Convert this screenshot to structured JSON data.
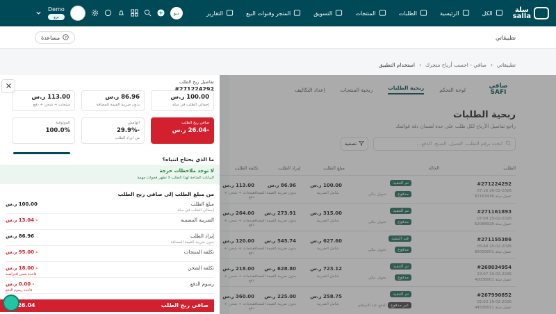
{
  "topbar": {
    "logo": "سلة\nsalla",
    "nav": [
      {
        "label": "الكل",
        "icon": "menu-icon"
      },
      {
        "label": "الرئيسية",
        "icon": "home-icon"
      },
      {
        "label": "الطلبات",
        "icon": "orders-icon"
      },
      {
        "label": "المنتجات",
        "icon": "products-icon"
      },
      {
        "label": "التسويق",
        "icon": "marketing-icon"
      },
      {
        "label": "المتجر وقنوات البيع",
        "icon": "store-channels-icon"
      },
      {
        "label": "التقارير",
        "icon": "reports-icon"
      }
    ],
    "avatar_text": "ديو",
    "user_name": "Demo",
    "user_badge": "برو"
  },
  "subbar": {
    "apps_label": "تطبيقاتي",
    "help_label": "مساعدة"
  },
  "breadcrumb": [
    "تطبيقاتي",
    "صافي - احسب أرباح متجرك",
    "استخدام التطبيق"
  ],
  "app": {
    "logo": "صافي\nSAFI",
    "tabs": [
      "لوحة التحكم",
      "ربحية الطلبات",
      "ربحية المنتجات",
      "إعداد التكاليف"
    ],
    "active_tab": 1,
    "title": "ربحية الطلبات",
    "subtitle": "راجع تفاصيل الأرباح لكل طلب على حدة لضمان دقة قوائمك",
    "search_placeholder": "ابحث برقم الطلب، العميل، المنتج، الدفع...",
    "filter_label": "تصفية",
    "columns": [
      "الطلب",
      "الحالة",
      "مبلغ الطلب",
      "إيراد الطلب",
      "تكلفة الطلب"
    ],
    "rows": [
      {
        "id": "#271224292",
        "date": "26-02-2026 07:16",
        "customer": "عميل سلة 82163436",
        "status": "تم التنفيذ",
        "payment": "مدفوع",
        "shipping": "تحويل بنكي",
        "amount": "100.00 ر.س",
        "amount_sub": "شامل الضريبة",
        "revenue": "86.96 ر.س",
        "revenue_sub": "بدون ضريبة القيمة المضافة",
        "cost": "113.00 ر.س",
        "cost_sub": "منتجات + شحن + دفع"
      },
      {
        "id": "#271161893",
        "date": "25-02-2026 07:09",
        "customer": "عميل سلة 62088928",
        "status": "تم التنفيذ",
        "payment": "مدفوع",
        "shipping": "تحويل بنكي",
        "amount": "315.00 ر.س",
        "amount_sub": "شامل الضريبة",
        "revenue": "273.91 ر.س",
        "revenue_sub": "بدون ضريبة القيمة المضافة",
        "cost": "264.00 ر.س",
        "cost_sub": "منتجات + شحن + دفع"
      },
      {
        "id": "#271155386",
        "date": "25-02-2026 05:48",
        "customer": "عميل سلة 85009001",
        "status": "قيد التنفيذ",
        "payment": "مدفوع",
        "shipping": "تحويل بنكي",
        "amount": "627.60 ر.س",
        "amount_sub": "شامل الضريبة",
        "revenue": "545.74 ر.س",
        "revenue_sub": "بدون ضريبة القيمة المضافة",
        "cost": "120.00 ر.س",
        "cost_sub": "منتجات + شحن + دفع"
      },
      {
        "id": "#268034954",
        "date": "19-02-2026 22:07",
        "customer": "عميل سلة 40038001",
        "status": "تم التنفيذ",
        "payment": "مدفوع",
        "shipping": "تحويل بنكي",
        "amount": "723.12 ر.س",
        "amount_sub": "شامل الضريبة",
        "revenue": "628.80 ر.س",
        "revenue_sub": "بدون ضريبة القيمة المضافة",
        "cost": "218.00 ر.س",
        "cost_sub": "منتجات + شحن + دفع"
      },
      {
        "id": "#267990852",
        "date": "19-02-2026 02:03",
        "customer": "عميل سلة 44538011",
        "status": "تم التنفيذ",
        "payment": "غير مدفوع",
        "shipping": "الدفع عند الاستلام",
        "amount": "258.75 ر.س",
        "amount_sub": "شامل الضريبة",
        "revenue": "225.00 ر.س",
        "revenue_sub": "بدون ضريبة القيمة المضافة",
        "cost": "360.00 ر.س",
        "cost_sub": "منتجات + شحن + دفع"
      }
    ]
  },
  "panel": {
    "title": "تفاصيل ربح الطلب",
    "order_no": "#271224292",
    "metrics": [
      {
        "value": "100.00 ر.س",
        "label": "إجمالي الطلب في سلة",
        "style": "normal"
      },
      {
        "value": "86.96 ر.س",
        "label": "بدون ضريبة القيمة المضافة",
        "style": "normal"
      },
      {
        "value": "113.00 ر.س",
        "label": "منتجات + شحن + دفع",
        "style": "normal"
      },
      {
        "title": "صافي ربح الطلب",
        "value": "-26.04 ر.س",
        "label": "",
        "style": "red"
      },
      {
        "title": "الهامش",
        "value": "-29.9%",
        "label": "من ايراد الطلب",
        "style": "normal"
      },
      {
        "title": "الموثوقية",
        "value": "100.0%",
        "label": "",
        "style": "progress",
        "progress": 1.0
      }
    ],
    "attention_title": "ما الذي يحتاج انتباه؟",
    "ok_title": "لا توجد ملاحظات حرجة",
    "ok_sub": "البيانات المتاحة لهذا الطلب لا تظهر فجوات مهمة",
    "breakdown_title": "من مبلغ الطلب إلى صافي ربح الطلب",
    "lines": [
      {
        "label": "مبلغ الطلب",
        "sub": "إجمالي الطلب في سلة",
        "value": "100.00 ر.س",
        "vsub": "",
        "neg": false
      },
      {
        "label": "الضريبة المضمنة",
        "sub": "",
        "value": "- 13.04 ر.س",
        "vsub": "",
        "neg": true
      },
      {
        "label": "إيراد الطلب",
        "sub": "بدون ضريبة القيمة المضافة",
        "value": "86.96 ر.س",
        "vsub": "",
        "neg": false
      },
      {
        "label": "تكلفة المنتجات",
        "sub": "",
        "value": "- 95.00 ر.س",
        "vsub": "",
        "neg": true
      },
      {
        "label": "تكلفة الشحن",
        "sub": "",
        "value": "- 18.00 ر.س",
        "vsub": "قاعدة شحن افتراضية",
        "neg": true
      },
      {
        "label": "رسوم الدفع",
        "sub": "",
        "value": "- 0.00 ر.س",
        "vsub": "قاعدة رسوم الدفع",
        "neg": true
      }
    ],
    "footer_label": "صافي ربح الطلب",
    "footer_value": "-26.04"
  }
}
